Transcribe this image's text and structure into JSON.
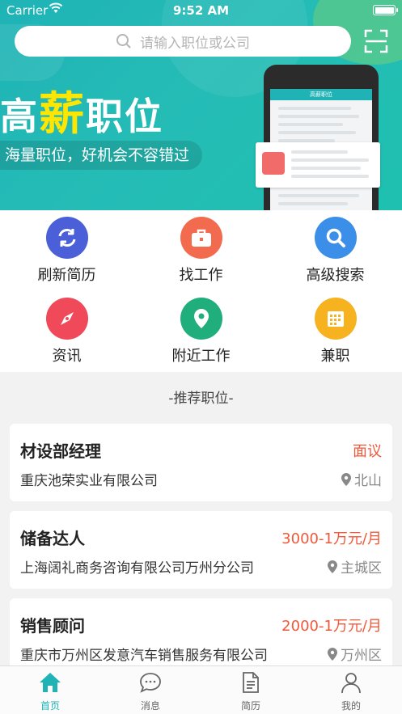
{
  "status": {
    "carrier": "Carrier",
    "time": "9:52 AM"
  },
  "search": {
    "placeholder": "请输入职位或公司"
  },
  "banner": {
    "title_a": "高",
    "title_hl": "薪",
    "title_b": "职位",
    "subtitle": "海量职位，好机会不容错过",
    "phone_bar": "高薪职位"
  },
  "menu": [
    {
      "label": "刷新简历",
      "icon": "refresh-icon",
      "color": "#4a5fd8"
    },
    {
      "label": "找工作",
      "icon": "briefcase-icon",
      "color": "#f36b4f"
    },
    {
      "label": "高级搜索",
      "icon": "search-icon",
      "color": "#3b8fe8"
    },
    {
      "label": "资讯",
      "icon": "compass-icon",
      "color": "#f0495a"
    },
    {
      "label": "附近工作",
      "icon": "location-icon",
      "color": "#1fae7c"
    },
    {
      "label": "兼职",
      "icon": "calendar-icon",
      "color": "#f7b21f"
    }
  ],
  "section_title": "-推荐职位-",
  "jobs": [
    {
      "title": "材设部经理",
      "salary": "面议",
      "company": "重庆池荣实业有限公司",
      "location": "北山"
    },
    {
      "title": "储备达人",
      "salary": "3000-1万元/月",
      "company": "上海阔礼商务咨询有限公司万州分公司",
      "location": "主城区"
    },
    {
      "title": "销售顾问",
      "salary": "2000-1万元/月",
      "company": "重庆市万州区发意汽车销售服务有限公司",
      "location": "万州区"
    }
  ],
  "tabs": [
    {
      "label": "首页",
      "icon": "home-icon",
      "active": true
    },
    {
      "label": "消息",
      "icon": "message-icon",
      "active": false
    },
    {
      "label": "简历",
      "icon": "resume-icon",
      "active": false
    },
    {
      "label": "我的",
      "icon": "profile-icon",
      "active": false
    }
  ],
  "colors": {
    "accent": "#1fb3b6",
    "salary": "#f0583a"
  }
}
